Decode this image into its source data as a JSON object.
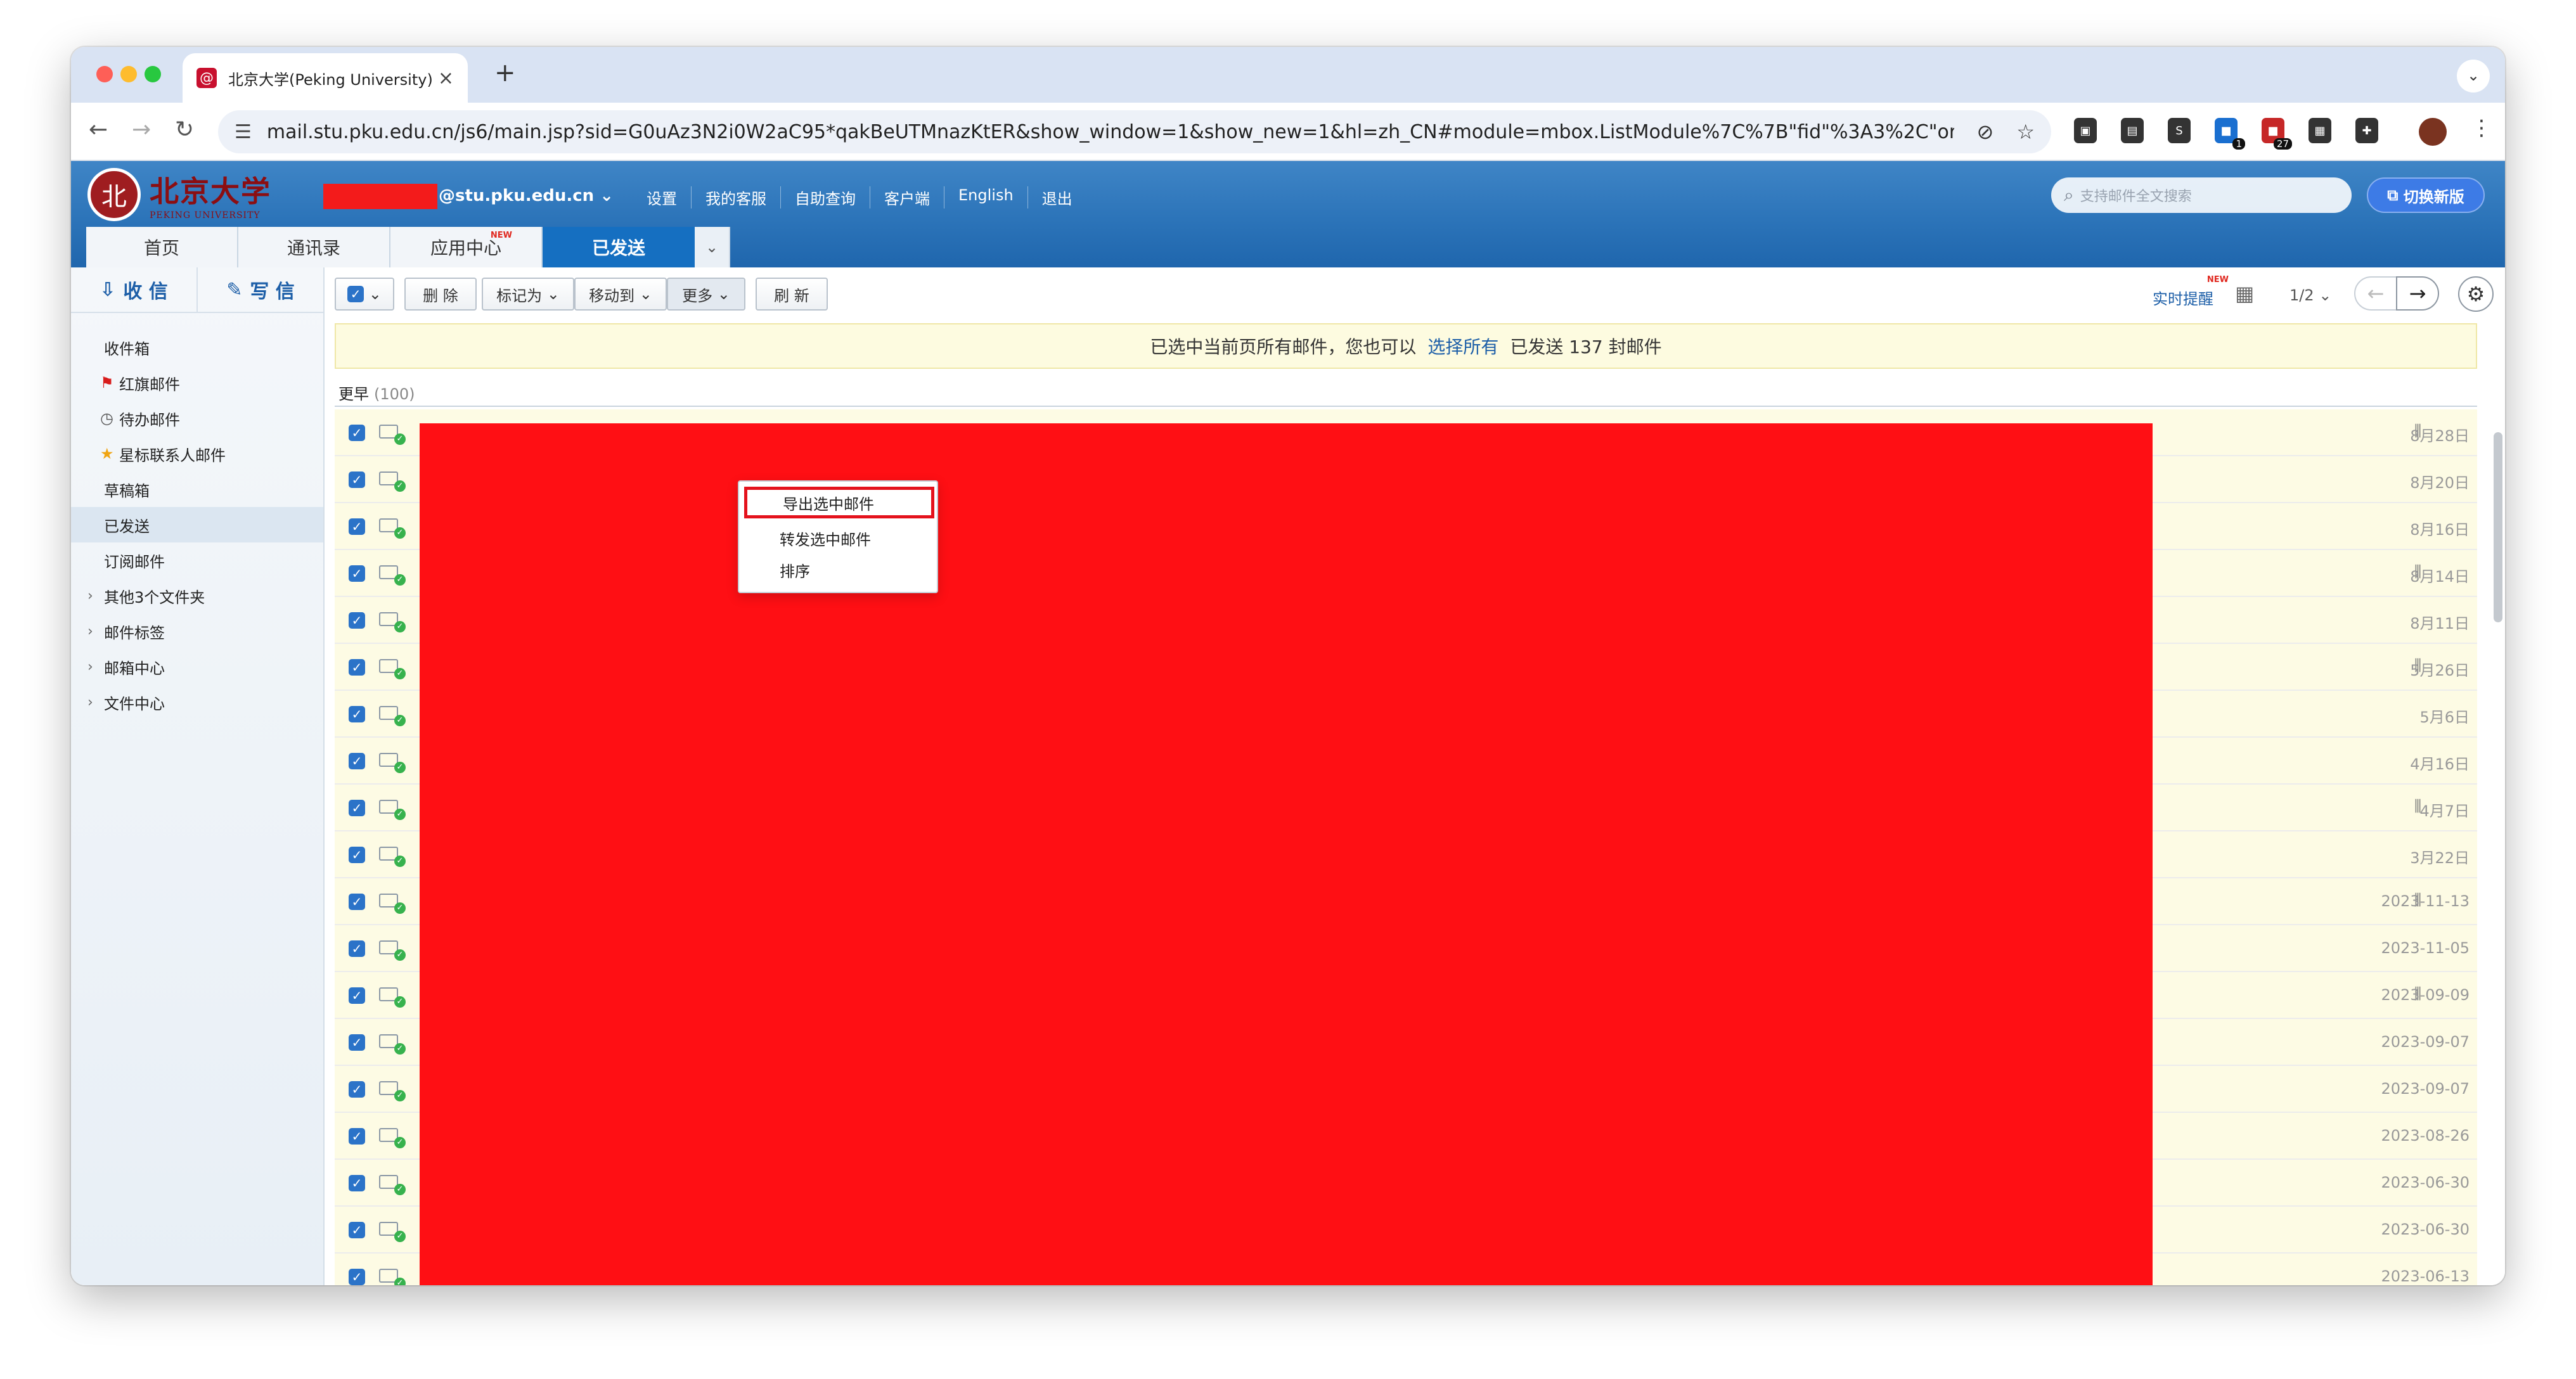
{
  "browser": {
    "tab_title": "北京大学(Peking University)",
    "tab_favicon": "@",
    "url": "mail.stu.pku.edu.cn/js6/main.jsp?sid=G0uAz3N2i0W2aC95*qakBeUTMnazKtER&show_window=1&show_new=1&hl=zh_CN#module=mbox.ListModule%7C%7B\"fid\"%3A3%2C\"order\"%3A\"date\"%2C\"...",
    "badge_1": "1",
    "badge_2": "27",
    "nav_icons": [
      "back-arrow-icon",
      "forward-arrow-icon",
      "reload-icon"
    ],
    "extension_icons": [
      "extension-icon-1",
      "extension-icon-2",
      "extension-icon-3",
      "extension-icon-4",
      "extension-icon-5",
      "extension-icon-6",
      "puzzle-icon"
    ]
  },
  "header": {
    "logo_cn": "北京大学",
    "logo_en": "PEKING UNIVERSITY",
    "account_domain": "@stu.pku.edu.cn",
    "links": [
      "设置",
      "我的客服",
      "自助查询",
      "客户端",
      "English",
      "退出"
    ],
    "search_placeholder": "支持邮件全文搜索",
    "switch_button": "切换新版",
    "brand_color": "#2c74b9"
  },
  "main_tabs": [
    {
      "label": "首页"
    },
    {
      "label": "通讯录"
    },
    {
      "label": "应用中心",
      "badge": "NEW"
    },
    {
      "label": "已发送",
      "active": true
    }
  ],
  "sidebar": {
    "receive": "收 信",
    "compose": "写 信",
    "folders": [
      {
        "label": "收件箱"
      },
      {
        "label": "红旗邮件",
        "icon": "red-flag-icon"
      },
      {
        "label": "待办邮件",
        "icon": "clock-icon"
      },
      {
        "label": "星标联系人邮件",
        "icon": "star-icon"
      },
      {
        "label": "草稿箱"
      },
      {
        "label": "已发送",
        "selected": true
      },
      {
        "label": "订阅邮件"
      },
      {
        "label": "其他3个文件夹",
        "expandable": true
      },
      {
        "label": "邮件标签",
        "expandable": true
      },
      {
        "label": "邮箱中心",
        "expandable": true
      },
      {
        "label": "文件中心",
        "expandable": true
      }
    ]
  },
  "toolbar": {
    "delete": "删 除",
    "mark_as": "标记为",
    "move_to": "移动到",
    "more": "更多",
    "refresh": "刷 新",
    "realtime": "实时提醒",
    "realtime_badge": "NEW",
    "page": "1/2"
  },
  "dropdown": {
    "items": [
      "导出选中邮件",
      "转发选中邮件",
      "排序"
    ],
    "highlight_color": "#e4121c"
  },
  "notice": {
    "pre": "已选中当前页所有邮件，您也可以",
    "link": "选择所有",
    "post": "已发送 137 封邮件"
  },
  "group": {
    "label": "更早",
    "count": "(100)"
  },
  "rows": [
    {
      "date": "8月28日",
      "attachment": true
    },
    {
      "date": "8月20日",
      "attachment": false
    },
    {
      "date": "8月16日",
      "attachment": false
    },
    {
      "date": "8月14日",
      "attachment": true
    },
    {
      "date": "8月11日",
      "attachment": false
    },
    {
      "date": "5月26日",
      "attachment": true
    },
    {
      "date": "5月6日",
      "attachment": false
    },
    {
      "date": "4月16日",
      "attachment": false
    },
    {
      "date": "4月7日",
      "attachment": true
    },
    {
      "date": "3月22日",
      "attachment": false
    },
    {
      "date": "2023-11-13",
      "attachment": true
    },
    {
      "date": "2023-11-05",
      "attachment": false
    },
    {
      "date": "2023-09-09",
      "attachment": true
    },
    {
      "date": "2023-09-07",
      "attachment": false
    },
    {
      "date": "2023-09-07",
      "attachment": false
    },
    {
      "date": "2023-08-26",
      "attachment": false
    },
    {
      "date": "2023-06-30",
      "attachment": false
    },
    {
      "date": "2023-06-30",
      "attachment": false
    },
    {
      "date": "2023-06-13",
      "attachment": false
    }
  ],
  "redaction_color": "#ff0f14"
}
